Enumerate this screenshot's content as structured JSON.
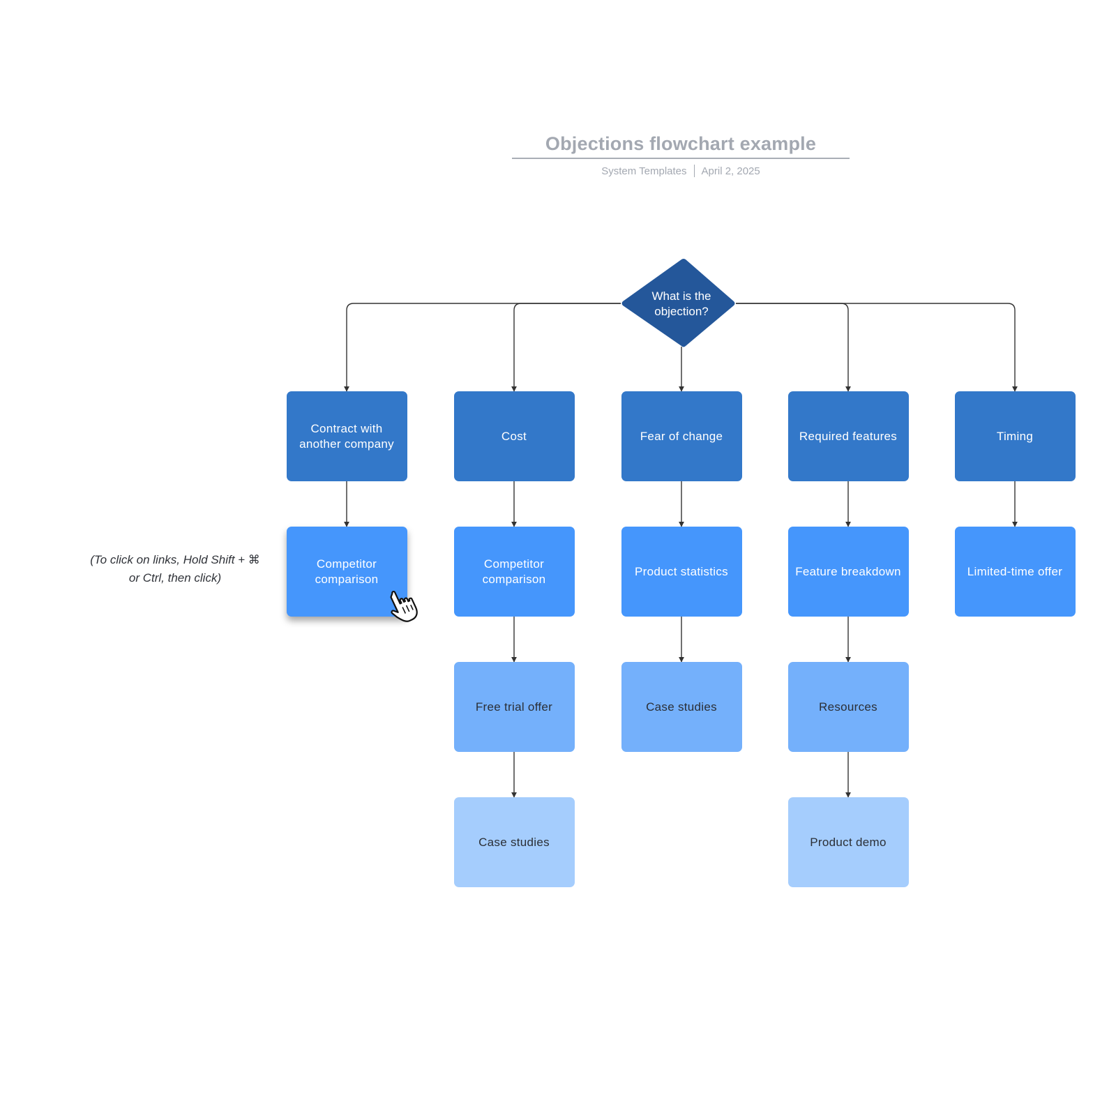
{
  "header": {
    "title": "Objections flowchart example",
    "author": "System Templates",
    "date": "April 2, 2025"
  },
  "hint": {
    "line1": "(To click on links, Hold Shift + ⌘",
    "line2": "or Ctrl, then click)"
  },
  "decision": {
    "line1": "What is the",
    "line2": "objection?"
  },
  "colors": {
    "decision": "#24579a",
    "level1": "#3378c9",
    "level2": "#4596fc",
    "level3": "#74b0fb",
    "level4": "#a5cdfd",
    "connector": "#333333",
    "title": "#a3a8b1"
  },
  "columns": [
    {
      "objection": "Contract with another company",
      "steps": [
        "Competitor comparison"
      ]
    },
    {
      "objection": "Cost",
      "steps": [
        "Competitor comparison",
        "Free trial offer",
        "Case studies"
      ]
    },
    {
      "objection": "Fear of change",
      "steps": [
        "Product statistics",
        "Case studies"
      ]
    },
    {
      "objection": "Required features",
      "steps": [
        "Feature breakdown",
        "Resources",
        "Product demo"
      ]
    },
    {
      "objection": "Timing",
      "steps": [
        "Limited-time offer"
      ]
    }
  ],
  "hovered_node": "Competitor comparison (Contract with another company)",
  "cursor": "pointer-hand-icon"
}
